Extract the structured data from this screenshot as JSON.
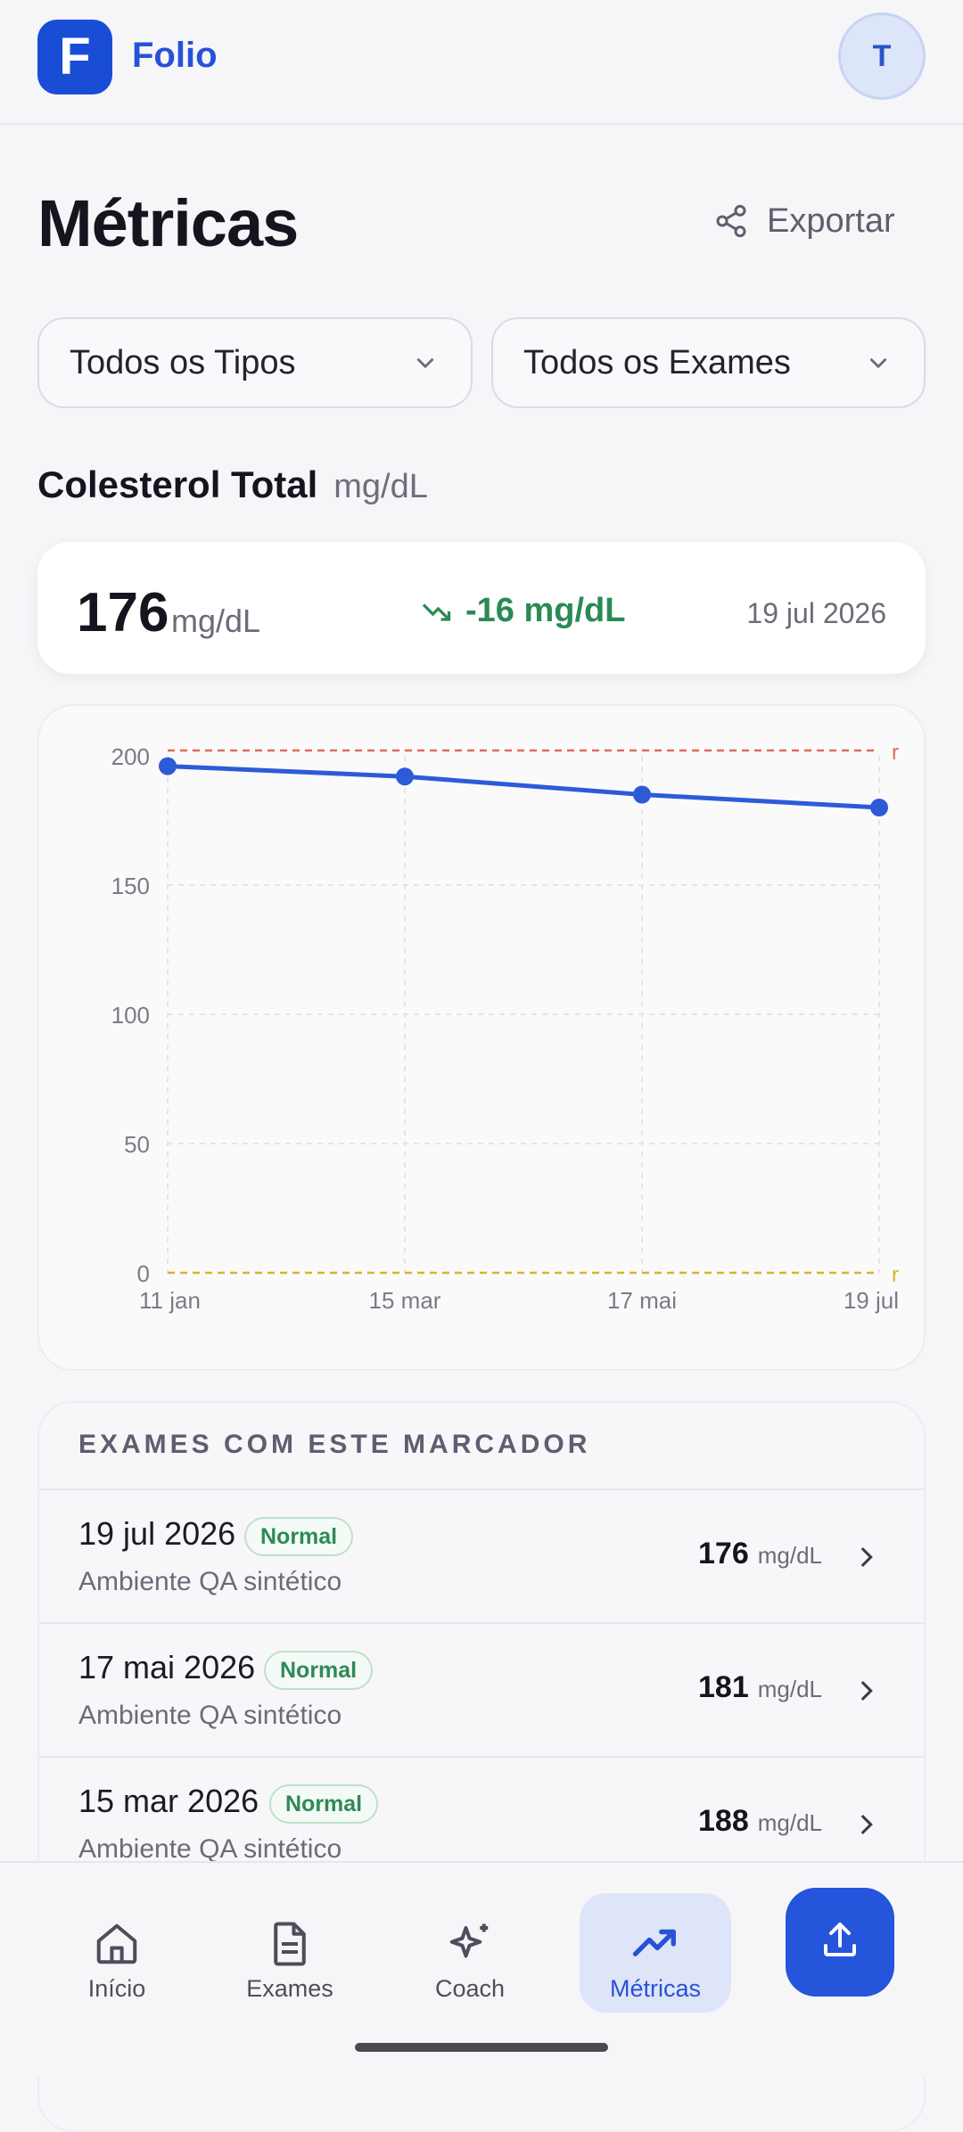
{
  "header": {
    "logo_letter": "F",
    "brand": "Folio",
    "avatar_initial": "T"
  },
  "page": {
    "title": "Métricas",
    "export_label": "Exportar"
  },
  "filters": {
    "type_selected": "Todos os Tipos",
    "exam_selected": "Todos os Exames"
  },
  "metric": {
    "name": "Colesterol Total",
    "unit": "mg/dL"
  },
  "summary": {
    "value": "176",
    "unit": "mg/dL",
    "delta": "-16 mg/dL",
    "date": "19 jul 2026"
  },
  "chart_data": {
    "type": "line",
    "categories": [
      "11 jan",
      "15 mar",
      "17 mai",
      "19 jul"
    ],
    "values": [
      196,
      192,
      185,
      180
    ],
    "ylim": [
      0,
      200
    ],
    "yticks": [
      200,
      150,
      100,
      50,
      0
    ],
    "reference_lines": [
      {
        "value": 200,
        "label": "r",
        "color": "#e06a5d"
      },
      {
        "value": 0,
        "label": "r",
        "color": "#d8b42a"
      }
    ],
    "line_color": "#2d5bd8",
    "grid": true
  },
  "exams_list": {
    "title": "EXAMES COM ESTE MARCADOR",
    "rows": [
      {
        "date": "19 jul 2026",
        "status": "Normal",
        "source": "Ambiente QA sintético",
        "value": "176",
        "unit": "mg/dL"
      },
      {
        "date": "17 mai 2026",
        "status": "Normal",
        "source": "Ambiente QA sintético",
        "value": "181",
        "unit": "mg/dL"
      },
      {
        "date": "15 mar 2026",
        "status": "Normal",
        "source": "Ambiente QA sintético",
        "value": "188",
        "unit": "mg/dL"
      }
    ]
  },
  "nav": {
    "items": [
      {
        "label": "Início",
        "icon": "home-icon"
      },
      {
        "label": "Exames",
        "icon": "document-icon"
      },
      {
        "label": "Coach",
        "icon": "sparkles-icon"
      },
      {
        "label": "Métricas",
        "icon": "trending-up-icon",
        "active": true
      }
    ],
    "upload_icon": "upload-icon"
  },
  "colors": {
    "accent": "#2455db",
    "positive": "#2a8a55"
  }
}
